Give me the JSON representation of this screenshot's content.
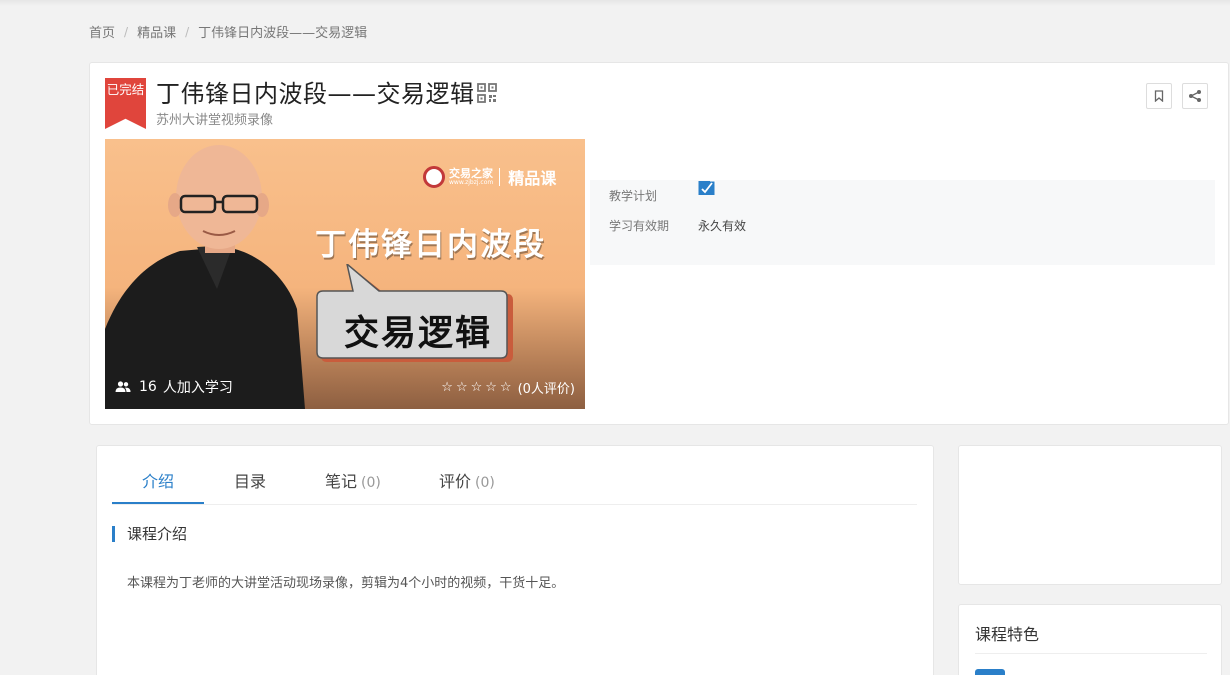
{
  "breadcrumb": {
    "items": [
      "首页",
      "精品课",
      "丁伟锋日内波段——交易逻辑"
    ],
    "separator": "/"
  },
  "course": {
    "status_badge": "已完结",
    "title": "丁伟锋日内波段——交易逻辑",
    "subtitle": "苏州大讲堂视频录像",
    "cover": {
      "brand_name": "交易之家",
      "brand_url": "www.zjbzj.com",
      "brand_tag": "精品课",
      "headline": "丁伟锋日内波段",
      "bubble_text": "交易逻辑",
      "students_count": "16",
      "students_label": "人加入学习",
      "stars": "☆☆☆☆☆",
      "rating_label": "(0人评价)"
    },
    "info": {
      "plan_label": "教学计划",
      "validity_label": "学习有效期",
      "validity_value": "永久有效"
    }
  },
  "tabs": [
    {
      "label": "介绍",
      "count": ""
    },
    {
      "label": "目录",
      "count": ""
    },
    {
      "label": "笔记",
      "count": "(0)"
    },
    {
      "label": "评价",
      "count": "(0)"
    }
  ],
  "intro": {
    "section_title": "课程介绍",
    "body": "本课程为丁老师的大讲堂活动现场录像，剪辑为4个小时的视频，干货十足。"
  },
  "sidebar": {
    "features_title": "课程特色"
  },
  "colors": {
    "accent": "#2a7fc9",
    "badge": "#e0453c",
    "cover_bg": "#f5b47d"
  }
}
